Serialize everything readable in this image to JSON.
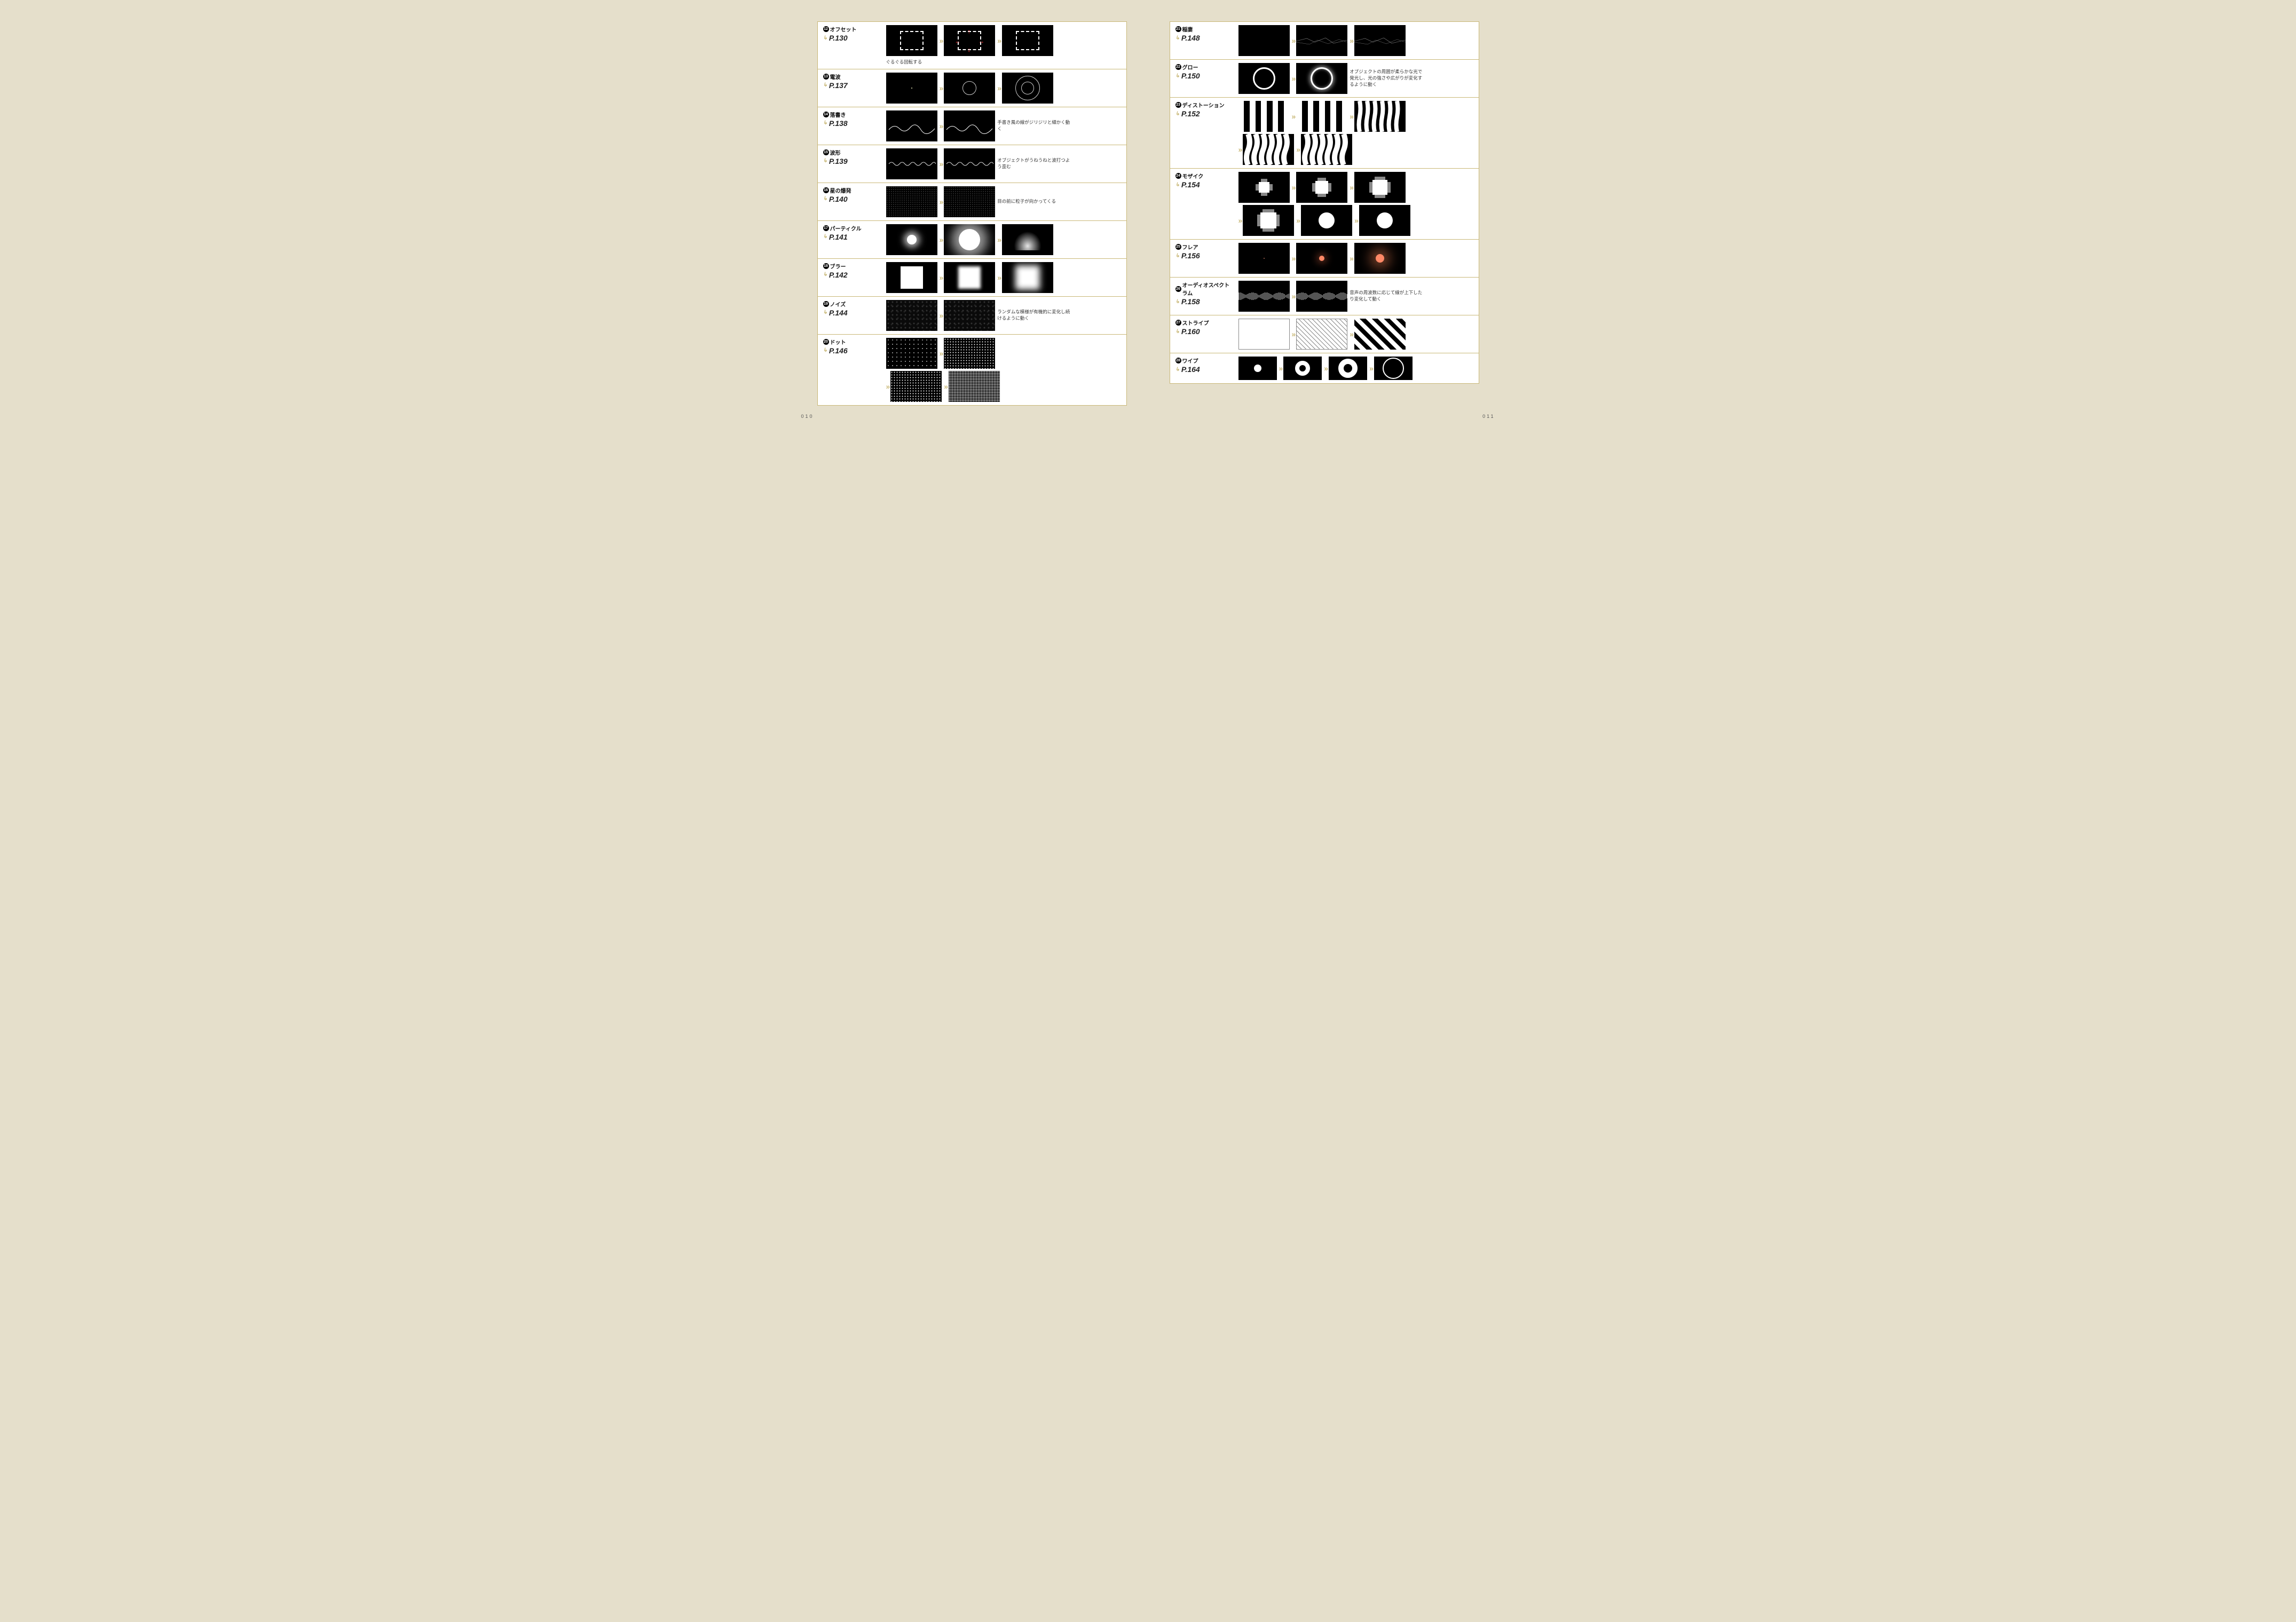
{
  "page_left_num": "010",
  "page_right_num": "011",
  "left_entries": [
    {
      "num": "12",
      "title": "オフセット",
      "page": "P.130",
      "caption_below": "ぐるぐる回転する",
      "graphic": "offset"
    },
    {
      "num": "13",
      "title": "電波",
      "page": "P.137",
      "graphic": "denpa"
    },
    {
      "num": "14",
      "title": "落書き",
      "page": "P.138",
      "caption": "手書き風の線がジリジリと細かく動く",
      "graphic": "rakugaki"
    },
    {
      "num": "15",
      "title": "波形",
      "page": "P.139",
      "caption": "オブジェクトがうねうねと波打つよう歪む",
      "graphic": "hakei"
    },
    {
      "num": "16",
      "title": "星の爆発",
      "page": "P.140",
      "caption": "目の前に粒子が向かってくる",
      "graphic": "star"
    },
    {
      "num": "17",
      "title": "パーティクル",
      "page": "P.141",
      "graphic": "particle"
    },
    {
      "num": "18",
      "title": "ブラー",
      "page": "P.142",
      "graphic": "blur"
    },
    {
      "num": "19",
      "title": "ノイズ",
      "page": "P.144",
      "caption": "ランダムな模様が有機的に変化し続けるように動く",
      "graphic": "noise"
    },
    {
      "num": "20",
      "title": "ドット",
      "page": "P.146",
      "graphic": "dot",
      "extra_row": true
    }
  ],
  "right_entries": [
    {
      "num": "21",
      "title": "稲妻",
      "page": "P.148",
      "graphic": "inazuma"
    },
    {
      "num": "22",
      "title": "グロー",
      "page": "P.150",
      "caption": "オブジェクトの周囲が柔らかな光で発光し、光の強さや広がりが変化するように動く",
      "graphic": "glow"
    },
    {
      "num": "23",
      "title": "ディストーション",
      "page": "P.152",
      "graphic": "distortion",
      "extra_row": true
    },
    {
      "num": "24",
      "title": "モザイク",
      "page": "P.154",
      "graphic": "mosaic",
      "extra_row": true
    },
    {
      "num": "25",
      "title": "フレア",
      "page": "P.156",
      "graphic": "flare"
    },
    {
      "num": "26",
      "title": "オーディオスペクトラム",
      "page": "P.158",
      "caption": "音声の周波数に応じて線が上下したり変化して動く",
      "graphic": "spectrum"
    },
    {
      "num": "27",
      "title": "ストライプ",
      "page": "P.160",
      "graphic": "stripe"
    },
    {
      "num": "28",
      "title": "ワイプ",
      "page": "P.164",
      "graphic": "wipe",
      "four_thumbs": true
    }
  ]
}
